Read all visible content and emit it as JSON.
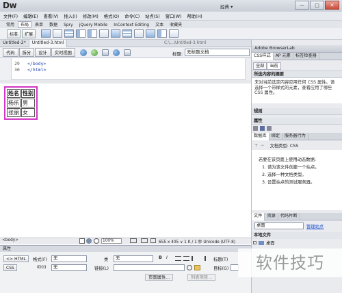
{
  "app": {
    "logo": "Dw",
    "workspace": "经典 ▾",
    "win_controls": [
      "—",
      "□",
      "✕"
    ]
  },
  "menu": [
    "文件(F)",
    "编辑(E)",
    "查看(V)",
    "插入(I)",
    "修改(M)",
    "格式(O)",
    "命令(C)",
    "站点(S)",
    "窗口(W)",
    "帮助(H)"
  ],
  "insert_tabs": [
    "常用",
    "布局",
    "表单",
    "数据",
    "Spry",
    "jQuery Mobile",
    "InContext Editing",
    "文本",
    "收藏夹"
  ],
  "insert_active": "布局",
  "insert_buttons": [
    "标准",
    "扩展"
  ],
  "doc_tabs": [
    "Untitled-2*",
    "Untitled-3.html"
  ],
  "doc_path": "C:\\...\\Untitled-3.html",
  "view_buttons": [
    "代码",
    "拆分",
    "设计",
    "实时视图"
  ],
  "title_label": "标题:",
  "title_value": "无标题文档",
  "code_lines": [
    {
      "num": "29",
      "text": "</body>"
    },
    {
      "num": "30",
      "text": "</html>"
    }
  ],
  "table": {
    "header": [
      "姓名",
      "性别"
    ],
    "rows": [
      [
        "杨乐",
        "男"
      ],
      [
        "张丽",
        "女"
      ]
    ]
  },
  "status": {
    "tag": "<body>",
    "zoom": "100%",
    "info": "655 x 405 ∨ 1 K / 1 秒 Unicode (UTF-8)"
  },
  "props": {
    "header": "属性",
    "html_btn": "<> HTML",
    "css_btn": "CSS",
    "format_label": "格式(F)",
    "format_value": "无",
    "class_label": "类",
    "class_value": "无",
    "id_label": "ID(I)",
    "id_value": "无",
    "link_label": "链接(L)",
    "title_label": "标题(T)",
    "target_label": "目标(G)",
    "page_props": "页面属性...",
    "list_item": "列表项目..."
  },
  "right": {
    "browserlab": "Adobe BrowserLab",
    "css_tabs": [
      "CSS样式",
      "AP 元素",
      "标签检查器"
    ],
    "css_subtabs": [
      "全部",
      "当前"
    ],
    "summary_title": "所选内容的摘要",
    "summary_text": "未对当前选定内容应用任何 CSS 属性。请选择一个带样式的元素，查看应用了哪些 CSS 属性。",
    "rules": "规则",
    "properties": "属性",
    "db_tabs": [
      "数据库",
      "绑定",
      "服务器行为"
    ],
    "doc_type": "文档类型: CSS",
    "db_intro": "若要在该页面上使用动态数据:",
    "db_steps": [
      "1. 请为该文件创建一个站点。",
      "2. 选择一种文档类型。",
      "3. 设置站点的测试服务器。"
    ],
    "db_links": [
      "站点",
      "文档类型",
      "测试服务器"
    ],
    "files_tabs": [
      "文件",
      "资源",
      "代码片断"
    ],
    "files_select": "桌面",
    "files_manage": "管理站点",
    "local_files": "本地文件",
    "desktop_item": "桌面"
  },
  "watermark": "软件技巧"
}
